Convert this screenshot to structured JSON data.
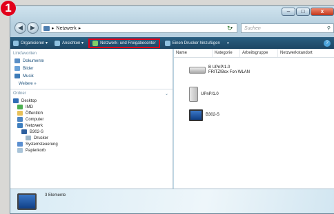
{
  "badge": "1",
  "window": {
    "caption_buttons": [
      "–",
      "□",
      "x"
    ],
    "nav": {
      "back_icon": "back-arrow-icon",
      "forward_icon": "forward-arrow-icon"
    },
    "address": {
      "separator": "▸",
      "path": "Netzwerk",
      "trail": "▸"
    },
    "search": {
      "placeholder": "Suchen",
      "icon": "search-icon"
    }
  },
  "toolbar": {
    "items": [
      "Organisieren ▾",
      "Ansichten ▾",
      "Netzwerk- und Freigabecenter",
      "Einen Drucker hinzufügen",
      "»"
    ],
    "help": "?"
  },
  "sidebar": {
    "favorites_title": "Linkfavoriten",
    "favorites": [
      "Dokumente",
      "Bilder",
      "Musik"
    ],
    "more": "Weitere »",
    "tree_title": "Ordner",
    "tree_chevron": "⌄",
    "tree": [
      "Desktop",
      "IMD",
      "Öffentlich",
      "Computer",
      "Netzwerk",
      "B302-S",
      "Drucker",
      "Systemsteuerung",
      "Papierkorb"
    ]
  },
  "list": {
    "columns": [
      "Name",
      "Kategorie",
      "Arbeitsgruppe",
      "Netzwerkstandort"
    ],
    "items": [
      {
        "line1": "B UPnP/1.0",
        "line2": "FRITZ!Box Fon WLAN"
      },
      {
        "line1": "UPnP/1.0",
        "line2": ""
      },
      {
        "line1": "B302-S",
        "line2": ""
      }
    ]
  },
  "details": {
    "count": "3 Elemente"
  },
  "colors": {
    "highlight": "#e2001a",
    "toolbar": "#1d4664",
    "link": "#1a4f7a"
  }
}
